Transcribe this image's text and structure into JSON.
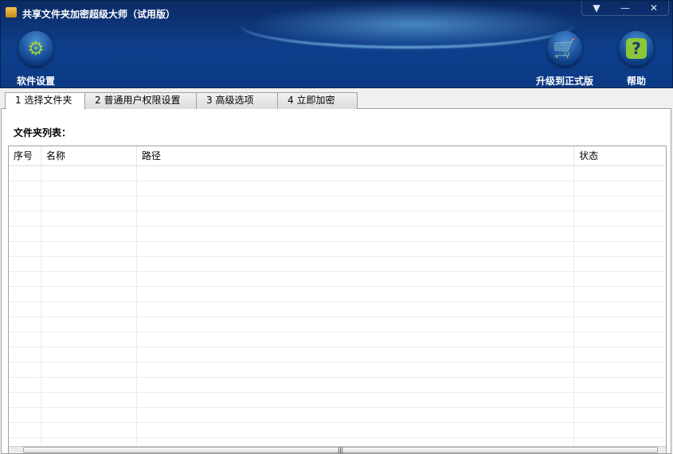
{
  "window": {
    "title": "共享文件夹加密超级大师（试用版）",
    "controls": {
      "menu": "▼",
      "minimize": "—",
      "close": "✕"
    }
  },
  "toolbar": {
    "settings": "软件设置",
    "upgrade": "升级到正式版",
    "help": "帮助"
  },
  "tabs": [
    {
      "label": "1 选择文件夹",
      "active": true
    },
    {
      "label": "2 普通用户权限设置"
    },
    {
      "label": "3 高级选项"
    },
    {
      "label": "4 立即加密"
    }
  ],
  "folder_list": {
    "label": "文件夹列表：",
    "columns": [
      "序号",
      "名称",
      "路径",
      "状态"
    ],
    "rows": []
  }
}
